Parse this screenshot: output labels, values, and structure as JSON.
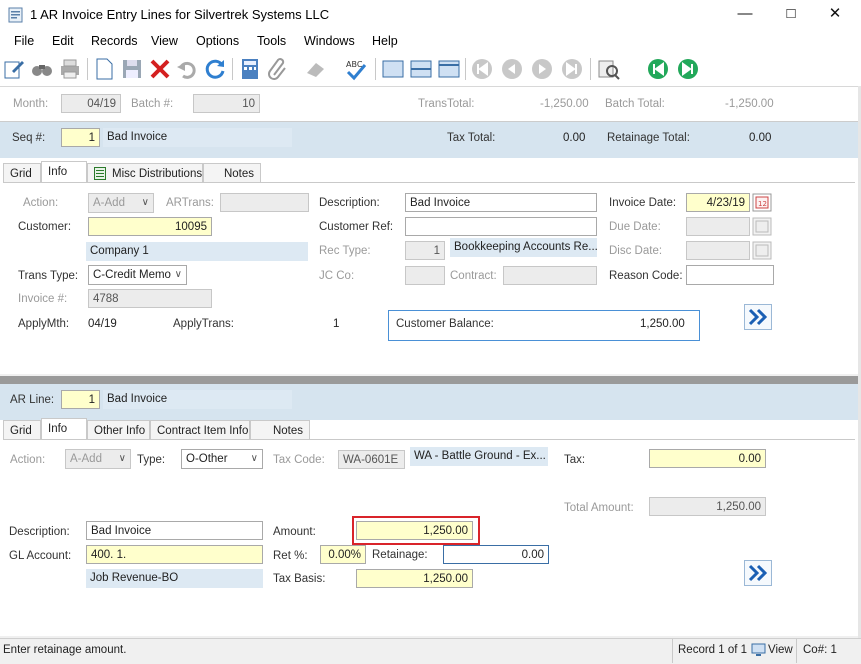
{
  "window": {
    "title": "1 AR Invoice Entry Lines for Silvertrek Systems LLC"
  },
  "menu": [
    "File",
    "Edit",
    "Records",
    "View",
    "Options",
    "Tools",
    "Windows",
    "Help"
  ],
  "header": {
    "month_label": "Month:",
    "month_value": "04/19",
    "batch_label": "Batch #:",
    "batch_value": "10",
    "trans_total_label": "TransTotal:",
    "trans_total_value": "-1,250.00",
    "batch_total_label": "Batch Total:",
    "batch_total_value": "-1,250.00"
  },
  "seq": {
    "label": "Seq #:",
    "value": "1",
    "desc": "Bad Invoice",
    "tax_total_label": "Tax Total:",
    "tax_total_value": "0.00",
    "retainage_total_label": "Retainage Total:",
    "retainage_total_value": "0.00"
  },
  "top_tabs": [
    "Grid",
    "Info",
    "Misc Distributions",
    "Notes"
  ],
  "info": {
    "action_label": "Action:",
    "action_value": "A-Add",
    "artrans_label": "ARTrans:",
    "customer_label": "Customer:",
    "customer_value": "10095",
    "customer_name": "Company 1",
    "trans_type_label": "Trans Type:",
    "trans_type_value": "C-Credit Memo",
    "invoice_label": "Invoice #:",
    "invoice_value": "4788",
    "applymth_label": "ApplyMth:",
    "applymth_value": "04/19",
    "applytrans_label": "ApplyTrans:",
    "applytrans_value": "1",
    "description_label": "Description:",
    "description_value": "Bad Invoice",
    "customer_ref_label": "Customer Ref:",
    "rec_type_label": "Rec Type:",
    "rec_type_value": "1",
    "rec_type_desc": "Bookkeeping Accounts Re...",
    "jc_co_label": "JC Co:",
    "contract_label": "Contract:",
    "customer_balance_label": "Customer Balance:",
    "customer_balance_value": "1,250.00",
    "invoice_date_label": "Invoice Date:",
    "invoice_date_value": "4/23/19",
    "due_date_label": "Due Date:",
    "disc_date_label": "Disc Date:",
    "reason_code_label": "Reason Code:"
  },
  "arline": {
    "label": "AR Line:",
    "value": "1",
    "desc": "Bad Invoice"
  },
  "bottom_tabs": [
    "Grid",
    "Info",
    "Other Info",
    "Contract Item Info",
    "Notes"
  ],
  "line": {
    "action_label": "Action:",
    "action_value": "A-Add",
    "type_label": "Type:",
    "type_value": "O-Other",
    "tax_code_label": "Tax Code:",
    "tax_code_value": "WA-0601E",
    "tax_code_desc": "WA - Battle Ground - Ex...",
    "tax_label": "Tax:",
    "tax_value": "0.00",
    "total_amount_label": "Total Amount:",
    "total_amount_value": "1,250.00",
    "description_label": "Description:",
    "description_value": "Bad Invoice",
    "amount_label": "Amount:",
    "amount_value": "1,250.00",
    "gl_account_label": "GL Account:",
    "gl_account_value": "400. 1.",
    "gl_account_desc": "Job Revenue-BO",
    "ret_pct_label": "Ret %:",
    "ret_pct_value": "0.00%",
    "retainage_label": "Retainage:",
    "retainage_value": "0.00",
    "tax_basis_label": "Tax Basis:",
    "tax_basis_value": "1,250.00"
  },
  "status": {
    "message": "Enter retainage amount.",
    "record": "Record 1 of 1",
    "view": "View",
    "co": "Co#: 1"
  },
  "colors": {
    "highlight_red": "#d9242a",
    "balance_border": "#4a90d6",
    "header_blue": "#d6e4ef",
    "required_yellow": "#ffffcc"
  }
}
